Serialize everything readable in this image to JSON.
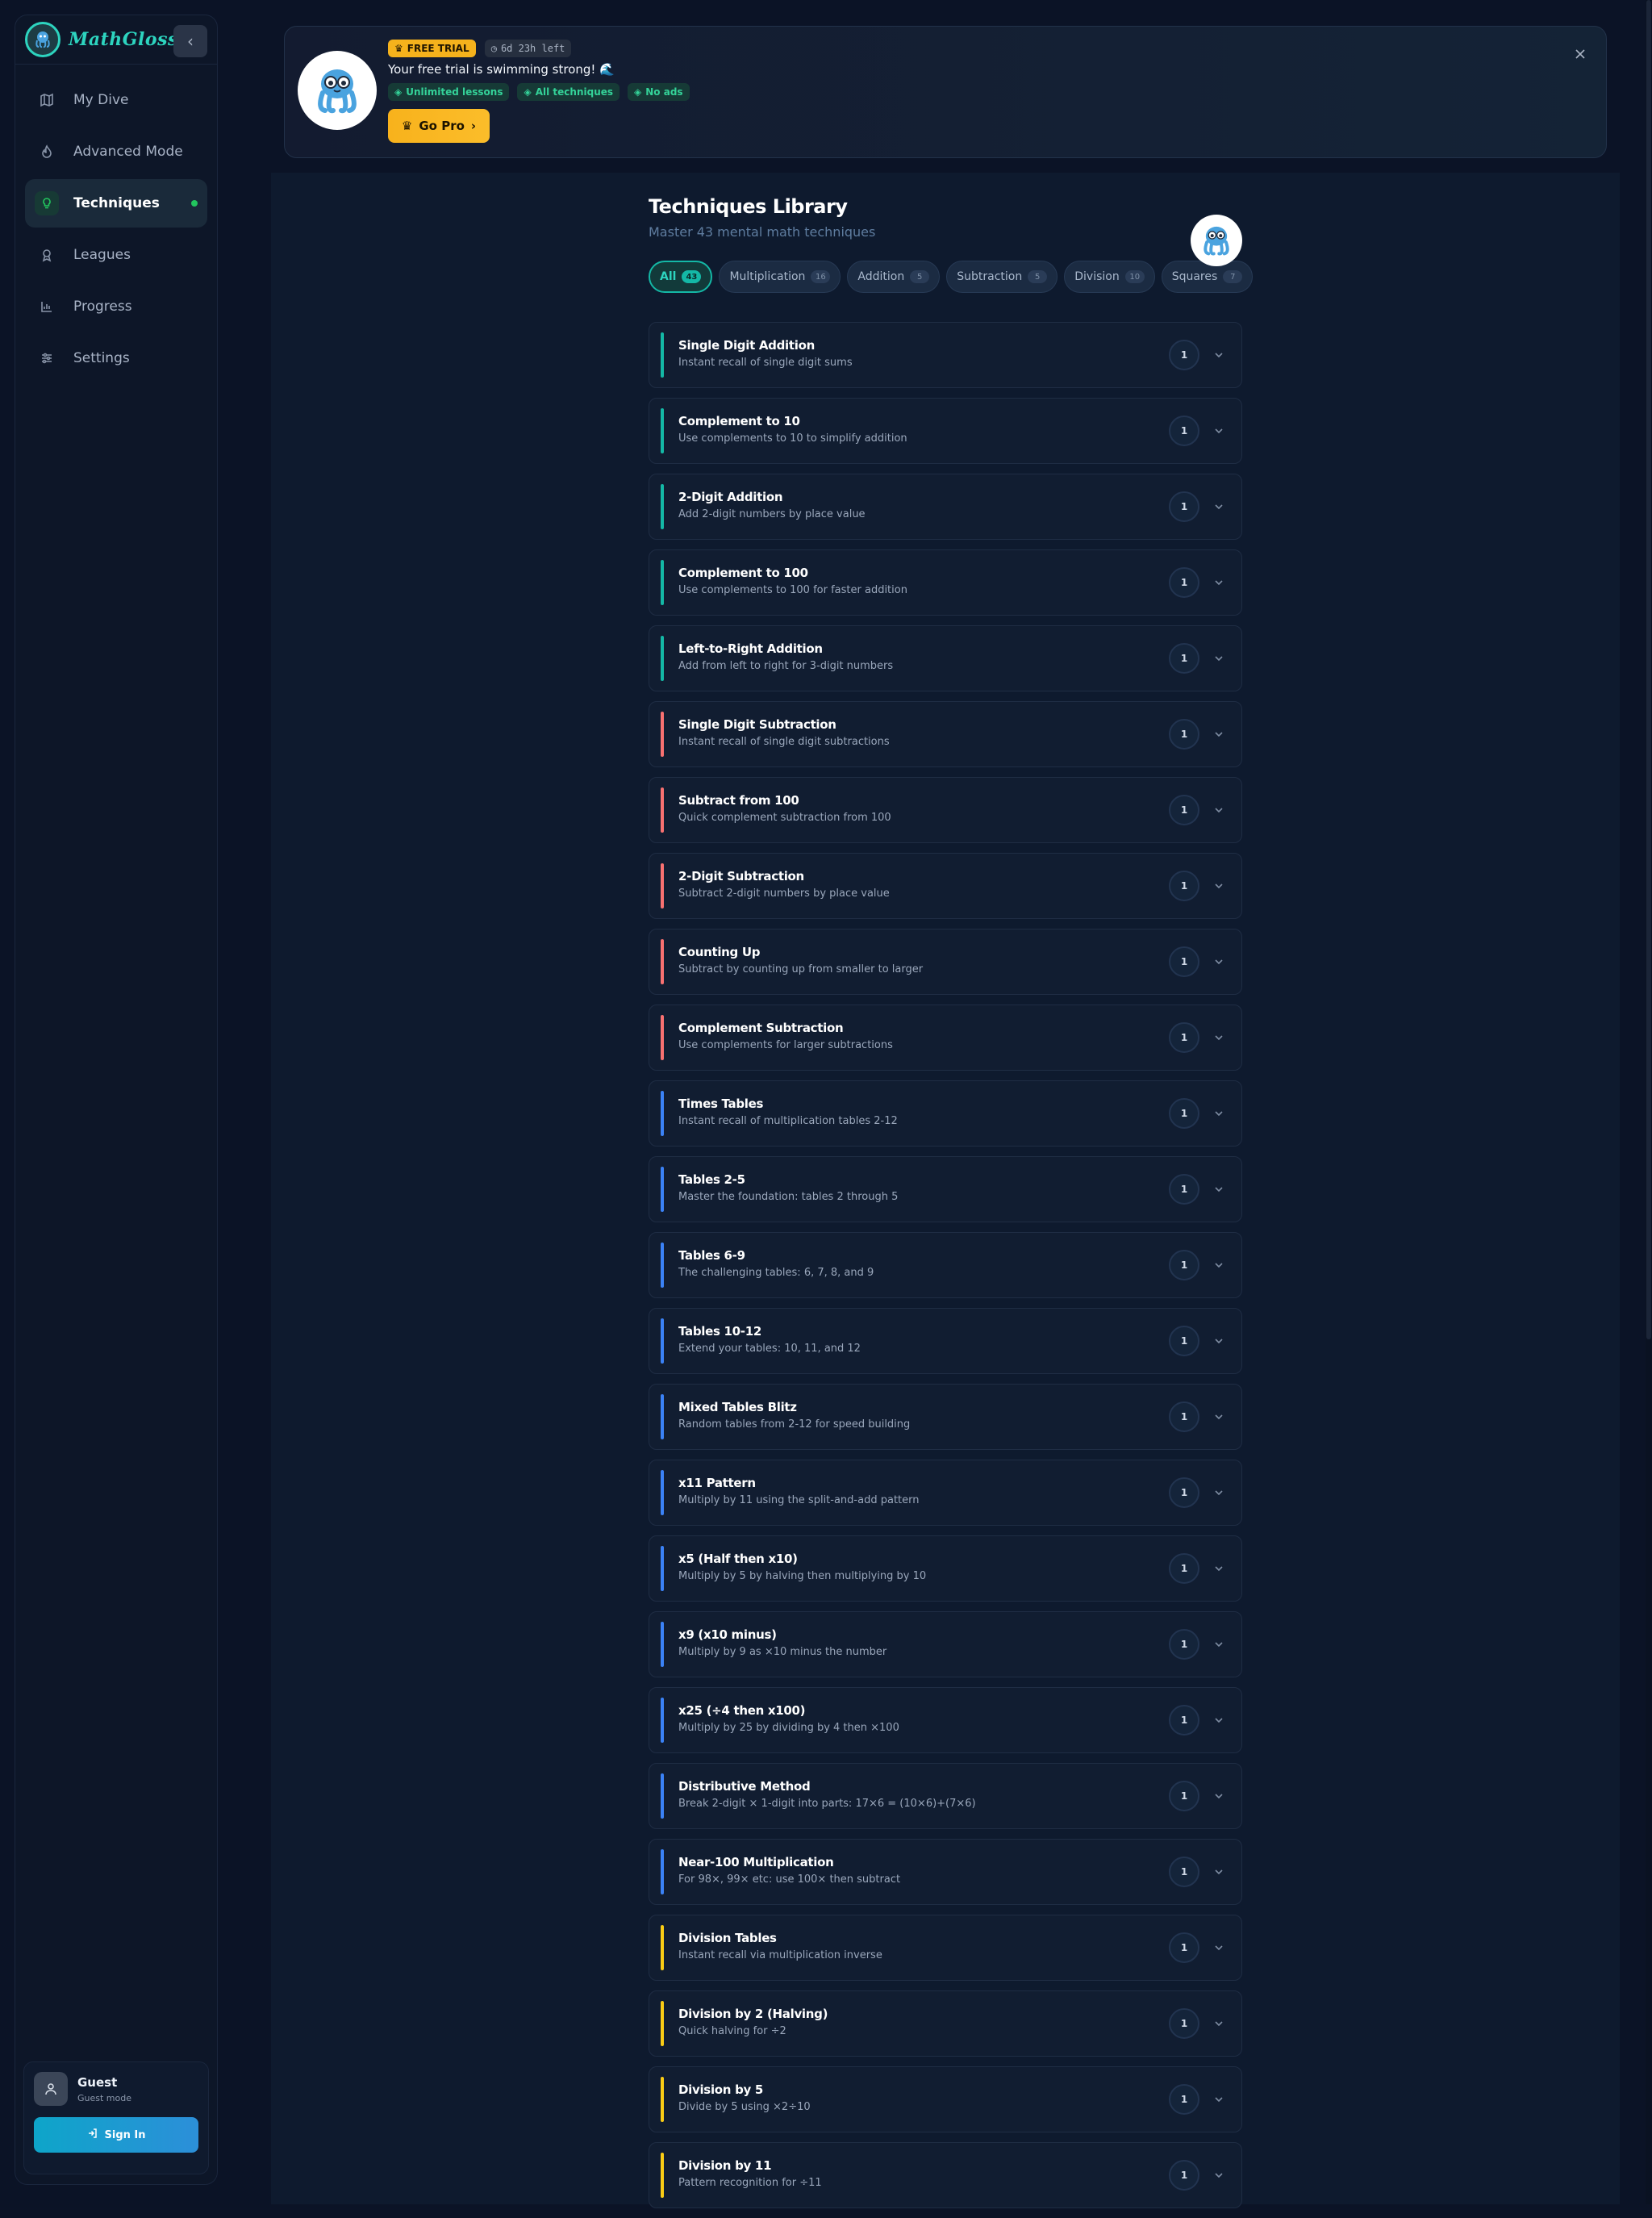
{
  "app": {
    "brand": "MathGlossa"
  },
  "sidebar": {
    "items": [
      {
        "label": "My Dive",
        "icon": "map-icon",
        "active": false
      },
      {
        "label": "Advanced Mode",
        "icon": "flame-icon",
        "active": false
      },
      {
        "label": "Techniques",
        "icon": "lightbulb-icon",
        "active": true
      },
      {
        "label": "Leagues",
        "icon": "award-icon",
        "active": false
      },
      {
        "label": "Progress",
        "icon": "chart-icon",
        "active": false
      },
      {
        "label": "Settings",
        "icon": "sliders-icon",
        "active": false
      }
    ],
    "guest": {
      "name": "Guest",
      "mode": "Guest mode",
      "signin_label": "Sign In"
    }
  },
  "banner": {
    "badge": "FREE TRIAL",
    "time_left": "6d 23h left",
    "title": "Your free trial is swimming strong! 🌊",
    "perks": [
      "Unlimited lessons",
      "All techniques",
      "No ads"
    ],
    "cta": "Go Pro"
  },
  "library": {
    "title": "Techniques Library",
    "subtitle": "Master 43 mental math techniques",
    "filters": [
      {
        "label": "All",
        "count": "43",
        "active": true
      },
      {
        "label": "Multiplication",
        "count": "16",
        "active": false
      },
      {
        "label": "Addition",
        "count": "5",
        "active": false
      },
      {
        "label": "Subtraction",
        "count": "5",
        "active": false
      },
      {
        "label": "Division",
        "count": "10",
        "active": false
      },
      {
        "label": "Squares",
        "count": "7",
        "active": false
      }
    ],
    "colors": {
      "addition": "#14b8a6",
      "subtraction": "#f87171",
      "multiplication": "#3b82f6",
      "division": "#facc15"
    },
    "items": [
      {
        "name": "Single Digit Addition",
        "desc": "Instant recall of single digit sums",
        "level": "1",
        "category": "addition"
      },
      {
        "name": "Complement to 10",
        "desc": "Use complements to 10 to simplify addition",
        "level": "1",
        "category": "addition"
      },
      {
        "name": "2-Digit Addition",
        "desc": "Add 2-digit numbers by place value",
        "level": "1",
        "category": "addition"
      },
      {
        "name": "Complement to 100",
        "desc": "Use complements to 100 for faster addition",
        "level": "1",
        "category": "addition"
      },
      {
        "name": "Left-to-Right Addition",
        "desc": "Add from left to right for 3-digit numbers",
        "level": "1",
        "category": "addition"
      },
      {
        "name": "Single Digit Subtraction",
        "desc": "Instant recall of single digit subtractions",
        "level": "1",
        "category": "subtraction"
      },
      {
        "name": "Subtract from 100",
        "desc": "Quick complement subtraction from 100",
        "level": "1",
        "category": "subtraction"
      },
      {
        "name": "2-Digit Subtraction",
        "desc": "Subtract 2-digit numbers by place value",
        "level": "1",
        "category": "subtraction"
      },
      {
        "name": "Counting Up",
        "desc": "Subtract by counting up from smaller to larger",
        "level": "1",
        "category": "subtraction"
      },
      {
        "name": "Complement Subtraction",
        "desc": "Use complements for larger subtractions",
        "level": "1",
        "category": "subtraction"
      },
      {
        "name": "Times Tables",
        "desc": "Instant recall of multiplication tables 2-12",
        "level": "1",
        "category": "multiplication"
      },
      {
        "name": "Tables 2-5",
        "desc": "Master the foundation: tables 2 through 5",
        "level": "1",
        "category": "multiplication"
      },
      {
        "name": "Tables 6-9",
        "desc": "The challenging tables: 6, 7, 8, and 9",
        "level": "1",
        "category": "multiplication"
      },
      {
        "name": "Tables 10-12",
        "desc": "Extend your tables: 10, 11, and 12",
        "level": "1",
        "category": "multiplication"
      },
      {
        "name": "Mixed Tables Blitz",
        "desc": "Random tables from 2-12 for speed building",
        "level": "1",
        "category": "multiplication"
      },
      {
        "name": "x11 Pattern",
        "desc": "Multiply by 11 using the split-and-add pattern",
        "level": "1",
        "category": "multiplication"
      },
      {
        "name": "x5 (Half then x10)",
        "desc": "Multiply by 5 by halving then multiplying by 10",
        "level": "1",
        "category": "multiplication"
      },
      {
        "name": "x9 (x10 minus)",
        "desc": "Multiply by 9 as ×10 minus the number",
        "level": "1",
        "category": "multiplication"
      },
      {
        "name": "x25 (÷4 then x100)",
        "desc": "Multiply by 25 by dividing by 4 then ×100",
        "level": "1",
        "category": "multiplication"
      },
      {
        "name": "Distributive Method",
        "desc": "Break 2-digit × 1-digit into parts: 17×6 = (10×6)+(7×6)",
        "level": "1",
        "category": "multiplication"
      },
      {
        "name": "Near-100 Multiplication",
        "desc": "For 98×, 99× etc: use 100× then subtract",
        "level": "1",
        "category": "multiplication"
      },
      {
        "name": "Division Tables",
        "desc": "Instant recall via multiplication inverse",
        "level": "1",
        "category": "division"
      },
      {
        "name": "Division by 2 (Halving)",
        "desc": "Quick halving for ÷2",
        "level": "1",
        "category": "division"
      },
      {
        "name": "Division by 5",
        "desc": "Divide by 5 using ×2÷10",
        "level": "1",
        "category": "division"
      },
      {
        "name": "Division by 11",
        "desc": "Pattern recognition for ÷11",
        "level": "1",
        "category": "division"
      }
    ]
  }
}
